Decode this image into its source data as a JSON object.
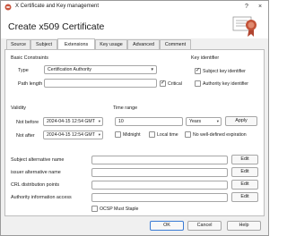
{
  "window": {
    "title": "X Certificate and Key management",
    "heading": "Create x509 Certificate",
    "controls": [
      "?",
      "×"
    ]
  },
  "tabs": [
    {
      "label": "Source",
      "active": false
    },
    {
      "label": "Subject",
      "active": false
    },
    {
      "label": "Extensions",
      "active": true
    },
    {
      "label": "Key usage",
      "active": false
    },
    {
      "label": "Advanced",
      "active": false
    },
    {
      "label": "Comment",
      "active": false
    }
  ],
  "basic_constraints": {
    "group_label": "Basic Constraints",
    "type_label": "Type",
    "type_value": "Certification Authority",
    "path_length_label": "Path length",
    "path_length_value": "",
    "critical_label": "Critical",
    "critical_checked": true
  },
  "key_identifier": {
    "group_label": "Key identifier",
    "subject_label": "Subject key identifier",
    "subject_checked": true,
    "authority_label": "Authority key identifier",
    "authority_checked": false
  },
  "validity": {
    "group_label": "Validity",
    "not_before_label": "Not before",
    "not_before_value": "2024-04-15 12:54 GMT",
    "not_after_label": "Not after",
    "not_after_value": "2024-04-15 12:54 GMT"
  },
  "time_range": {
    "group_label": "Time range",
    "amount_value": "10",
    "unit_value": "Years",
    "apply_label": "Apply",
    "midnight_label": "Midnight",
    "midnight_checked": false,
    "local_time_label": "Local time",
    "local_time_checked": false,
    "no_expiration_label": "No well-defined expiration",
    "no_expiration_checked": false
  },
  "extensions": {
    "edit_label": "Edit",
    "rows": [
      {
        "label": "Subject alternative name",
        "value": ""
      },
      {
        "label": "issuer alternative name",
        "value": ""
      },
      {
        "label": "CRL distribution points",
        "value": ""
      },
      {
        "label": "Authority information access",
        "value": ""
      }
    ],
    "ocsp_label": "OCSP Must Staple",
    "ocsp_checked": false
  },
  "footer": {
    "ok_label": "OK",
    "cancel_label": "Cancel",
    "help_label": "Help"
  },
  "colors": {
    "accent": "#3a7bd5",
    "seal": "#b0442f"
  }
}
